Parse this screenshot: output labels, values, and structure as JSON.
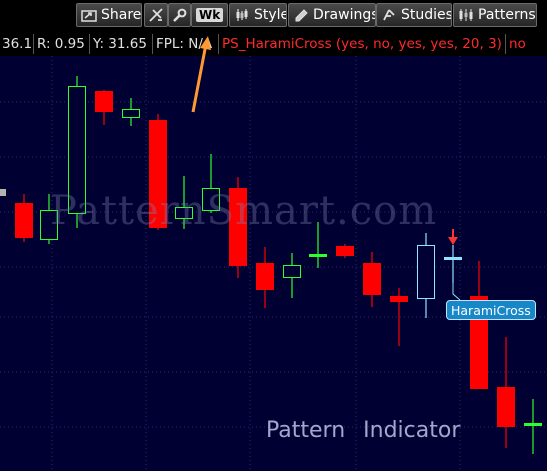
{
  "toolbar": {
    "share_label": "Share",
    "wk_label": "Wk",
    "style_label": "Style",
    "drawings_label": "Drawings",
    "studies_label": "Studies",
    "patterns_label": "Patterns"
  },
  "infobar": {
    "value_1": "36.1",
    "r_value": "R: 0.95",
    "y_value": "Y: 31.65",
    "fpl_value": "FPL: N/A",
    "study_label": "PS_HaramiCross (yes, no, yes, yes, 20, 3)",
    "trailing": "no"
  },
  "chart": {
    "watermark": "PatternSmart.com",
    "pattern_label": "HaramiCross",
    "footer_word_1": "Pattern",
    "footer_word_2": "Indicator"
  },
  "colors": {
    "background": "#000033",
    "grid": "#2b2b66",
    "bull": "#2cff2c",
    "bear": "#ff0000",
    "highlight": "#8fe4ff",
    "arrow": "#ff9933",
    "signal_arrow": "#ff3333"
  },
  "icons": {
    "share": "share-icon",
    "drawing_tools": "drawing-tools-icon",
    "wrench": "wrench-icon",
    "style": "style-icon",
    "drawings": "drawings-icon",
    "studies": "studies-icon",
    "patterns": "patterns-icon"
  }
}
